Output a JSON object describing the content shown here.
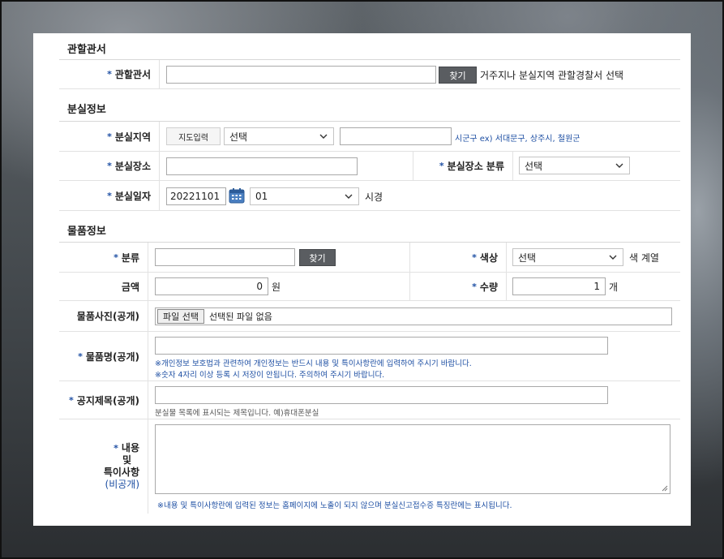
{
  "section_jurisdiction": {
    "title": "관할관서",
    "label": "관할관서",
    "search_button": "찾기",
    "help": "거주지나 분실지역 관할경찰서 선택"
  },
  "section_loss": {
    "title": "분실정보",
    "area": {
      "label": "분실지역",
      "map_button": "지도입력",
      "select_value": "선택",
      "hint": "시군구 ex) 서대문구, 상주시, 철원군"
    },
    "place": {
      "label": "분실장소",
      "category_label": "분실장소 분류",
      "category_value": "선택"
    },
    "date": {
      "label": "분실일자",
      "value": "20221101",
      "hour_value": "01",
      "hour_suffix": "시경"
    }
  },
  "section_item": {
    "title": "물품정보",
    "category": {
      "label": "분류",
      "search_button": "찾기"
    },
    "color": {
      "label": "색상",
      "select_value": "선택",
      "suffix": "색 계열"
    },
    "amount": {
      "label": "금액",
      "value": "0",
      "unit": "원"
    },
    "quantity": {
      "label": "수량",
      "value": "1",
      "unit": "개"
    },
    "photo": {
      "label": "물품사진(공개)",
      "button": "파일 선택",
      "status": "선택된 파일 없음"
    },
    "name": {
      "label": "물품명(공개)",
      "note1": "※개인정보 보호법과 관련하여 개인정보는 반드시 내용 및 특이사항란에 입력하여 주시기 바랍니다.",
      "note2": "※숫자 4자리 이상 등록 시 저장이 안됩니다. 주의하여 주시기 바랍니다."
    },
    "notice_title": {
      "label": "공지제목(공개)",
      "note": "분실물 목록에 표시되는 제목입니다. 예)휴대폰분실"
    },
    "content": {
      "label_line1": "내용",
      "label_line2": "및",
      "label_line3": "특이사항",
      "label_line4": "(비공개)",
      "note": "※내용 및 특이사항란에 입력된 정보는 홈페이지에 노출이 되지 않으며 분실신고접수증 특징란에는 표시됩니다."
    }
  },
  "required_mark": "*",
  "colors": {
    "accent_blue": "#1e4fa3",
    "button_dark": "#5a5d61"
  }
}
